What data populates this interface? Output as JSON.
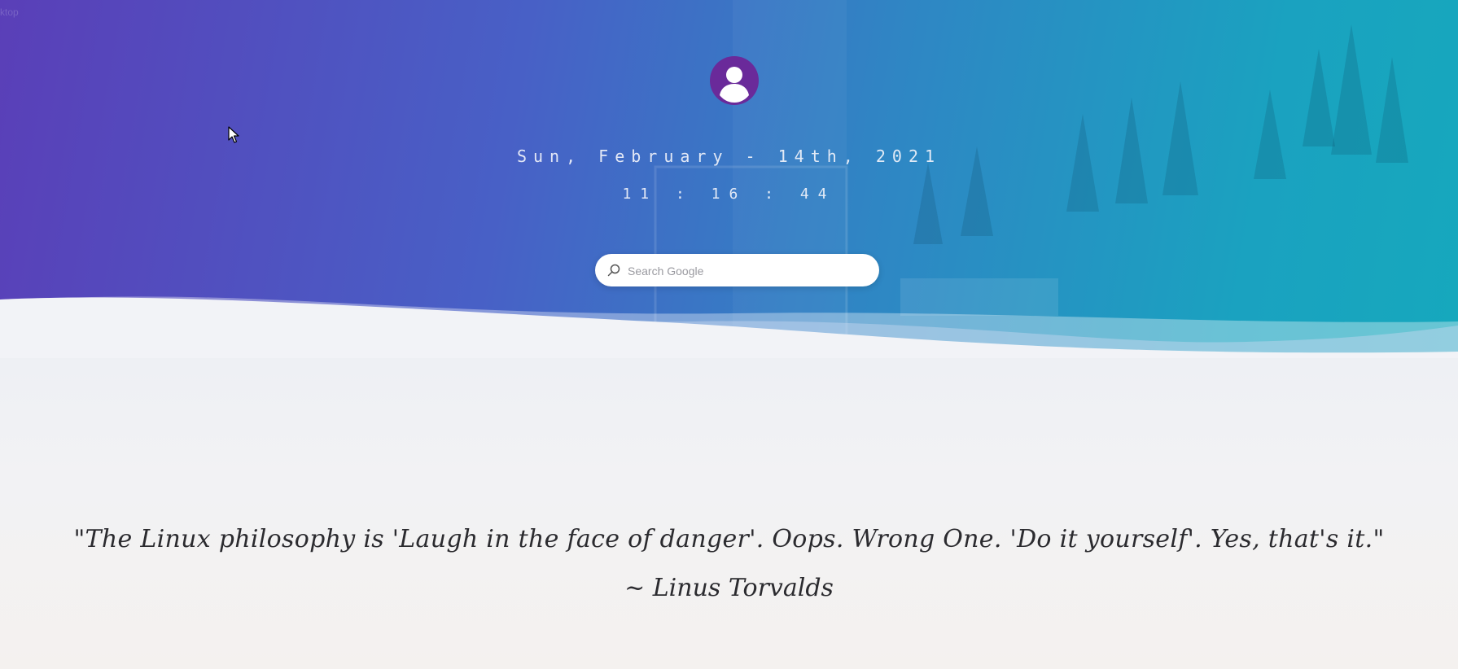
{
  "header": {
    "date": "Sun, February - 14th, 2021",
    "time": "11 : 16 : 44"
  },
  "search": {
    "placeholder": "Search Google",
    "value": ""
  },
  "quote": {
    "text": "\"The Linux philosophy is 'Laugh in the face of danger'. Oops. Wrong One. 'Do it yourself'. Yes, that's it.\"",
    "author": "~ Linus Torvalds"
  },
  "icons": {
    "avatar": "user-avatar-icon",
    "search": "search-icon",
    "cursor": "mouse-pointer-icon"
  },
  "colors": {
    "avatar": "#6a2a9a",
    "gradient_start": "#5a3fb8",
    "gradient_end": "#16a8bd",
    "quote_text": "#2b2b2f"
  }
}
